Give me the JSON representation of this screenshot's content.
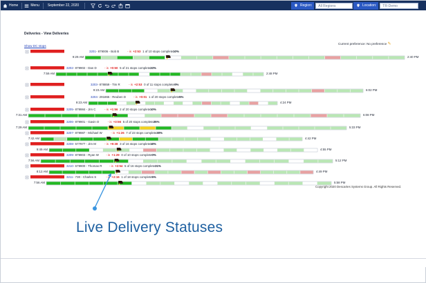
{
  "topbar": {
    "home": "Home",
    "menu": "Menu",
    "date": "September 22, 2020",
    "region_label": "Region:",
    "region_value": "All Regions",
    "location_label": "Location:",
    "location_value": "TR-Demo",
    "icons": [
      "home-icon",
      "menu-icon",
      "filter-icon",
      "refresh-icon",
      "undo-icon",
      "redo-icon",
      "export-icon",
      "calendar-icon"
    ]
  },
  "page": {
    "title": "Deliveries - View Deliveries",
    "show_dc_stops": "Show DC stops",
    "preference": "Current preference: No preference",
    "copyright": "Copyright 2020 Descartes Systems Group. All Rights Reserved.",
    "callout": "Live Delivery Statuses"
  },
  "colors": {
    "red": "#e02020",
    "green": "#22b822",
    "pale_green": "#b9e7b4",
    "pale_red": "#e8a1a1",
    "yellow": "#f1d21f",
    "link": "#2140b8",
    "callout": "#1d5fa0"
  },
  "deliveries": [
    {
      "route": "3201",
      "id": "879006",
      "driver": "Bob B",
      "lateness": "+2:53",
      "done": "1",
      "total": "10",
      "pct": "10%",
      "start": "9:29 AM",
      "end": "2:40 PM",
      "stops": [
        "L",
        "l",
        "L",
        "l",
        "L",
        "e",
        "d",
        "d",
        "r",
        "d",
        "l",
        "d",
        "d",
        "l",
        "d",
        "r",
        "d",
        "l",
        "d",
        "d"
      ]
    },
    {
      "route": "3202",
      "id": "879902",
      "driver": "Dan D",
      "lateness": "+0:50",
      "done": "5",
      "total": "21",
      "pct": "23%",
      "start": "7:59 AM",
      "end": "2:48 PM",
      "stops": [
        "L",
        "L",
        "L",
        "L",
        "L",
        "L",
        "L",
        "L",
        "e",
        "L",
        "L",
        "L",
        "d",
        "d",
        "r",
        "d",
        "d",
        "e",
        "d",
        "l"
      ]
    },
    {
      "route": "3203",
      "id": "878859",
      "driver": "Tim R",
      "lateness": "+2:53",
      "done": "0",
      "total": "11",
      "pct": "0%",
      "start": "9:23 AM",
      "end": "6:02 PM",
      "stops": [
        "L",
        "L",
        "L",
        "e",
        "d",
        "d",
        "e",
        "d",
        "d",
        "d",
        "d",
        "e",
        "d",
        "d",
        "d",
        "d",
        "r",
        "d",
        "d",
        "d"
      ]
    },
    {
      "route": "3204",
      "id": "291865",
      "driver": "Reuben D",
      "lateness": "+0:01",
      "done": "1",
      "total": "20",
      "pct": "5%",
      "start": "9:23 AM",
      "end": "4:24 PM",
      "stops": [
        "L",
        "L",
        "L",
        "e",
        "d",
        "e",
        "d",
        "d",
        "e",
        "d",
        "e",
        "d",
        "r",
        "d",
        "d",
        "e",
        "d",
        "r",
        "e",
        "d"
      ]
    },
    {
      "route": "3205",
      "id": "879984",
      "driver": "Jim C",
      "lateness": "+1:56",
      "done": "2",
      "total": "20",
      "pct": "10%",
      "start": "7:31 AM",
      "end": "6:08 PM",
      "stops": [
        "L",
        "L",
        "L",
        "L",
        "L",
        "L",
        "e",
        "d",
        "r",
        "r",
        "d",
        "r",
        "d",
        "d",
        "d",
        "d",
        "d",
        "r",
        "d",
        "l"
      ]
    },
    {
      "route": "3206",
      "id": "879901",
      "driver": "Gavin O",
      "lateness": "+3:56",
      "done": "5",
      "total": "20",
      "pct": "25%",
      "start": "7:29 AM",
      "end": "5:33 PM",
      "stops": [
        "L",
        "L",
        "L",
        "L",
        "L",
        "y",
        "L",
        "y",
        "L",
        "d",
        "e",
        "d",
        "d",
        "d",
        "e",
        "d",
        "d",
        "d",
        "d",
        "d"
      ]
    },
    {
      "route": "3207",
      "id": "879987",
      "driver": "Michael W",
      "lateness": "+1:26",
      "done": "7",
      "total": "23",
      "pct": "30%",
      "start": "7:42 AM",
      "end": "4:42 PM",
      "stops": [
        "L",
        "l",
        "L",
        "L",
        "L",
        "L",
        "y",
        "L",
        "L",
        "d",
        "d",
        "d",
        "d",
        "e",
        "d",
        "d",
        "d",
        "e",
        "d",
        "d"
      ]
    },
    {
      "route": "3208",
      "id": "577977",
      "driver": "Jim M",
      "lateness": "+9:38",
      "done": "3",
      "total": "16",
      "pct": "18%",
      "start": "9:49 AM",
      "end": "4:55 PM",
      "stops": [
        "L",
        "L",
        "L",
        "e",
        "d",
        "d",
        "e",
        "r",
        "d",
        "d",
        "d",
        "d",
        "e",
        "d",
        "e",
        "d",
        "e",
        "d",
        "d",
        "e"
      ]
    },
    {
      "route": "3209",
      "id": "879903",
      "driver": "Ryan W",
      "lateness": "+1:29",
      "done": "0",
      "total": "10",
      "pct": "0%",
      "start": "7:56 AM",
      "end": "5:12 PM",
      "stops": [
        "L",
        "L",
        "L",
        "L",
        "L",
        "L",
        "e",
        "d",
        "d",
        "d",
        "e",
        "d",
        "d",
        "e",
        "d",
        "d",
        "d",
        "e",
        "d",
        "d"
      ]
    },
    {
      "route": "3210",
      "id": "679900",
      "driver": "Thomas R",
      "lateness": "+2:54",
      "done": "5",
      "total": "16",
      "pct": "31%",
      "start": "8:12 AM",
      "end": "4:49 PM",
      "stops": [
        "L",
        "L",
        "L",
        "L",
        "L",
        "e",
        "d",
        "r",
        "d",
        "d",
        "r",
        "d",
        "r",
        "d",
        "d",
        "r",
        "d",
        "d",
        "d",
        "r"
      ]
    },
    {
      "route": "3211",
      "id": "730",
      "driver": "Charles S",
      "lateness": "+2:16",
      "done": "1",
      "total": "18",
      "pct": "5%",
      "start": "7:56 AM",
      "end": "5:58 PM",
      "stops": [
        "L",
        "L",
        "L",
        "L",
        "L",
        "L",
        "e",
        "d",
        "d",
        "e",
        "d",
        "e",
        "d",
        "d",
        "d",
        "e",
        "d",
        "d",
        "e",
        "d"
      ]
    }
  ]
}
